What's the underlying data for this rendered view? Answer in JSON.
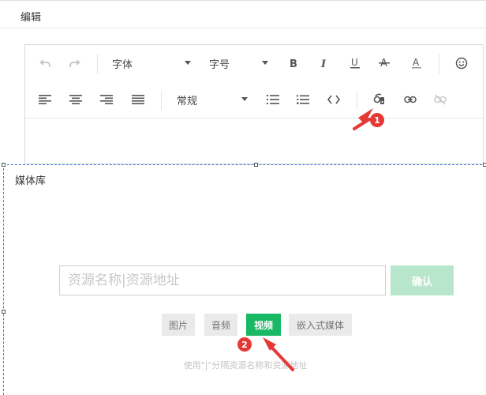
{
  "header": {
    "title": "编辑"
  },
  "toolbar": {
    "font_label": "字体",
    "size_label": "字号",
    "paragraph_label": "常规",
    "icons": [
      "undo-icon",
      "redo-icon",
      "bold-icon",
      "italic-icon",
      "underline-icon",
      "strikethrough-icon",
      "font-color-icon",
      "emoji-icon",
      "align-left-icon",
      "align-center-icon",
      "align-right-icon",
      "justify-icon",
      "bullet-list-icon",
      "numbered-list-icon",
      "code-icon",
      "media-icon",
      "link-icon",
      "unlink-icon"
    ]
  },
  "media": {
    "title": "媒体库",
    "input_placeholder": "资源名称|资源地址",
    "confirm_label": "确认",
    "types": [
      "图片",
      "音频",
      "视频",
      "嵌入式媒体"
    ],
    "active_type": "视频",
    "hint": "使用\"|\"分隔资源名称和资源地址"
  },
  "annotations": {
    "badge1": "1",
    "badge2": "2",
    "color": "#e53935"
  },
  "colors": {
    "accent": "#19b865",
    "accent_light": "#b8e6cc",
    "selection": "#3a7bd5"
  }
}
